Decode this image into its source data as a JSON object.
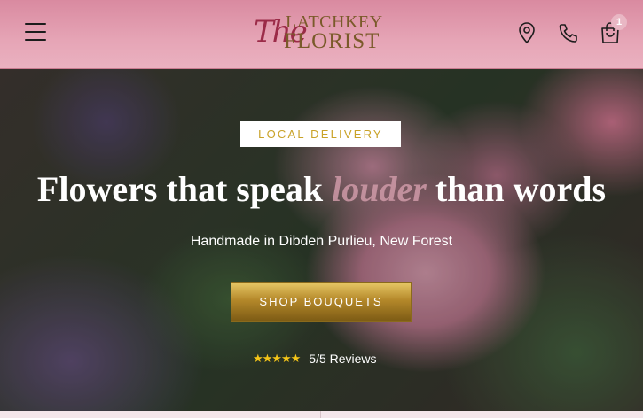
{
  "header": {
    "logo": {
      "the": "The",
      "line1": "LATCHKEY",
      "line2": "FLORIST"
    },
    "cart_count": "1",
    "icons": [
      "menu-icon",
      "location-pin-icon",
      "phone-icon",
      "shopping-bag-icon"
    ]
  },
  "hero": {
    "badge": "LOCAL DELIVERY",
    "headline_before": "Flowers that speak",
    "headline_accent": "louder",
    "headline_after": "than words",
    "subheading": "Handmade in Dibden Purlieu, New Forest",
    "cta": "SHOP BOUQUETS",
    "stars": "★★★★★",
    "reviews": "5/5 Reviews"
  },
  "colors": {
    "header_pink": "#e6a5b6",
    "logo_crimson": "#9b2b48",
    "logo_gold": "#7a5a2a",
    "badge_gold_text": "#c9a227",
    "cta_gold": "#b4882a",
    "star_yellow": "#f5c518"
  }
}
